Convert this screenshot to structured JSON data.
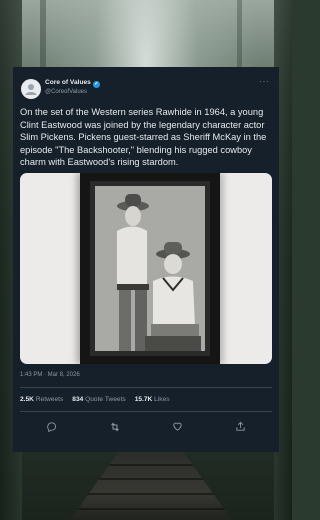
{
  "tweet": {
    "display_name": "Core of Values",
    "handle": "@CoreofValues",
    "more_icon": "more-dots-icon",
    "body": "On the set of the Western series Rawhide in 1964, a young Clint Eastwood was joined by the legendary character actor Slim Pickens. Pickens guest-starred as Sheriff McKay in the episode \"The Backshooter,\" blending his rugged cowboy charm with Eastwood's rising stardom.",
    "timestamp": "1:43 PM · Mar 8, 2026",
    "stats": {
      "retweets_count": "2.5K",
      "retweets_label": "Retweets",
      "quotes_count": "834",
      "quotes_label": "Quote Tweets",
      "likes_count": "15.7K",
      "likes_label": "Likes"
    },
    "actions": [
      "reply-icon",
      "retweet-icon",
      "like-icon",
      "share-icon"
    ]
  },
  "colors": {
    "card_bg": "#15202b",
    "text": "#e7e9ea",
    "muted": "#8b98a5",
    "verified": "#1d9bf0",
    "divider": "#38444d"
  }
}
